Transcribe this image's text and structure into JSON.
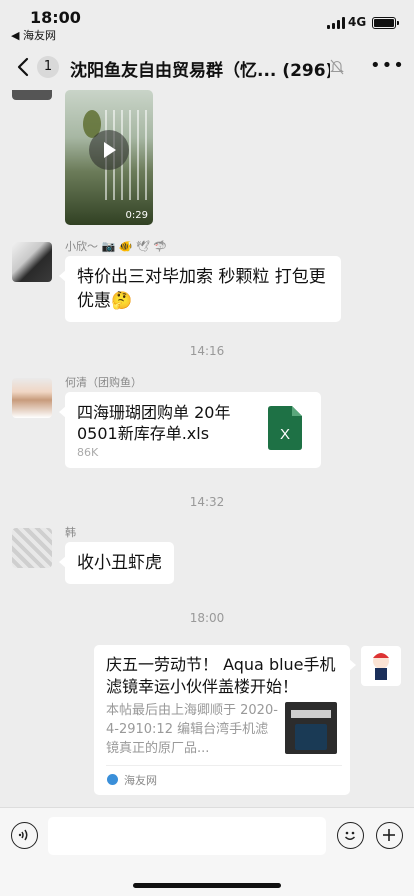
{
  "status_bar": {
    "time": "18:00",
    "back_app": "◀ 海友网",
    "network": "4G"
  },
  "nav": {
    "unread_count": "1",
    "title": "沈阳鱼友自由贸易群（忆...",
    "member_count": "(296)"
  },
  "messages": {
    "video": {
      "duration": "0:29"
    },
    "msg1": {
      "sender": "小欣～ 📷 🐠 🕊 🦈",
      "text": "特价出三对毕加索 秒颗粒 打包更优惠🤔"
    },
    "time1": "14:16",
    "msg2": {
      "sender": "何清（团购鱼）",
      "file_name": "四海珊瑚团购单 20年0501新库存单.xls",
      "file_size": "86K",
      "file_icon_letter": "X"
    },
    "time2": "14:32",
    "msg3": {
      "sender": "韩",
      "text": "收小丑虾虎"
    },
    "time3": "18:00",
    "msg4": {
      "title": "庆五一劳动节！ Aqua blue手机滤镜幸运小伙伴盖楼开始！",
      "description": "本帖最后由上海卿顺于 2020-4-2910:12 编辑台湾手机滤镜真正的原厂品...",
      "source": "海友网"
    }
  },
  "input": {
    "placeholder": ""
  },
  "colors": {
    "background": "#ededed",
    "bubble": "#ffffff",
    "excel_green": "#1e7145",
    "timestamp": "#999999"
  },
  "icons": [
    "back-chevron-icon",
    "mute-bell-icon",
    "more-icon",
    "play-icon",
    "excel-file-icon",
    "voice-icon",
    "emoji-icon",
    "plus-icon"
  ]
}
